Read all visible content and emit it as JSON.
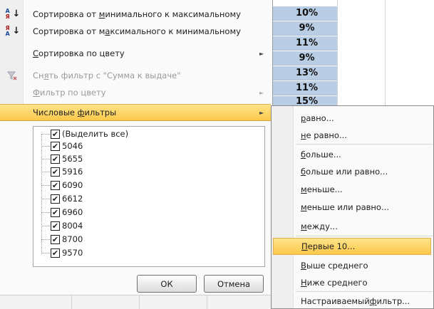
{
  "sheet": {
    "values": [
      "10%",
      "9%",
      "11%",
      "9%",
      "13%",
      "11%",
      "15%"
    ]
  },
  "menu": {
    "sort_asc_pre": "Сортировка от ",
    "sort_asc_key": "м",
    "sort_asc_post": "инимального к максимальному",
    "sort_desc_pre": "Сортировка от м",
    "sort_desc_key": "а",
    "sort_desc_post": "ксимального к минимальному",
    "sort_color_key": "С",
    "sort_color_post": "ортировка по цвету",
    "clear_pre": "Сн",
    "clear_key": "я",
    "clear_post": "ть фильтр с \"Сумма к выдаче\"",
    "color_filter_key": "Ф",
    "color_filter_post": "ильтр по цвету",
    "number_filters_pre": "Числовые ",
    "number_filters_key": "ф",
    "number_filters_post": "ильтры"
  },
  "checklist": {
    "items": [
      {
        "label": "(Выделить все)",
        "checked": true
      },
      {
        "label": "5046",
        "checked": true
      },
      {
        "label": "5655",
        "checked": true
      },
      {
        "label": "5916",
        "checked": true
      },
      {
        "label": "6090",
        "checked": true
      },
      {
        "label": "6612",
        "checked": true
      },
      {
        "label": "6960",
        "checked": true
      },
      {
        "label": "8004",
        "checked": true
      },
      {
        "label": "8700",
        "checked": true
      },
      {
        "label": "9570",
        "checked": true
      }
    ],
    "check_glyph": "✔"
  },
  "buttons": {
    "ok": "ОК",
    "cancel": "Отмена"
  },
  "submenu": {
    "eq_key": "р",
    "eq_post": "авно...",
    "neq_key": "н",
    "neq_post": "е равно...",
    "gt_key": "б",
    "gt_post": "ольше...",
    "gte_key": "б",
    "gte_post": "ольше или равно...",
    "lt_key": "м",
    "lt_post": "еньше...",
    "lte_key": "м",
    "lte_post": "еньше или равно...",
    "between_key": "м",
    "between_post": "ежду...",
    "top10_key": "П",
    "top10_post": "ервые 10...",
    "above_key": "В",
    "above_post": "ыше среднего",
    "below_key": "Н",
    "below_post": "иже среднего",
    "custom_pre": "Настраиваемый ",
    "custom_key": "ф",
    "custom_post": "ильтр..."
  },
  "colors": {
    "highlight": "#fbc94a",
    "cell": "#b9cde5"
  }
}
